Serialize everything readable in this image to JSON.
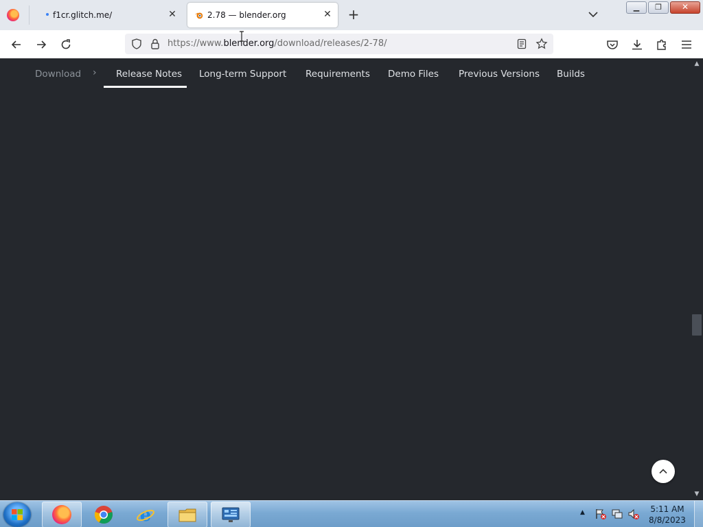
{
  "browser": {
    "tabs": [
      {
        "title": "f1cr.glitch.me/",
        "active": false
      },
      {
        "title": "2.78 — blender.org",
        "active": true
      }
    ],
    "url": {
      "prefix": "https://www.",
      "host": "blender.org",
      "path": "/download/releases/2-78/"
    }
  },
  "subnav": {
    "items": [
      "Download",
      "Release Notes",
      "Long-term Support",
      "Requirements",
      "Demo Files",
      "Previous Versions",
      "Builds"
    ],
    "active": "Release Notes"
  },
  "taskbar": {
    "time": "5:11 AM",
    "date": "8/8/2023",
    "apps": [
      "firefox-icon",
      "chrome-icon",
      "internet-explorer-icon",
      "file-explorer-icon",
      "control-panel-icon"
    ]
  },
  "colors": {
    "page_bg": "#25282d",
    "accent_underline": "#ffffff"
  }
}
